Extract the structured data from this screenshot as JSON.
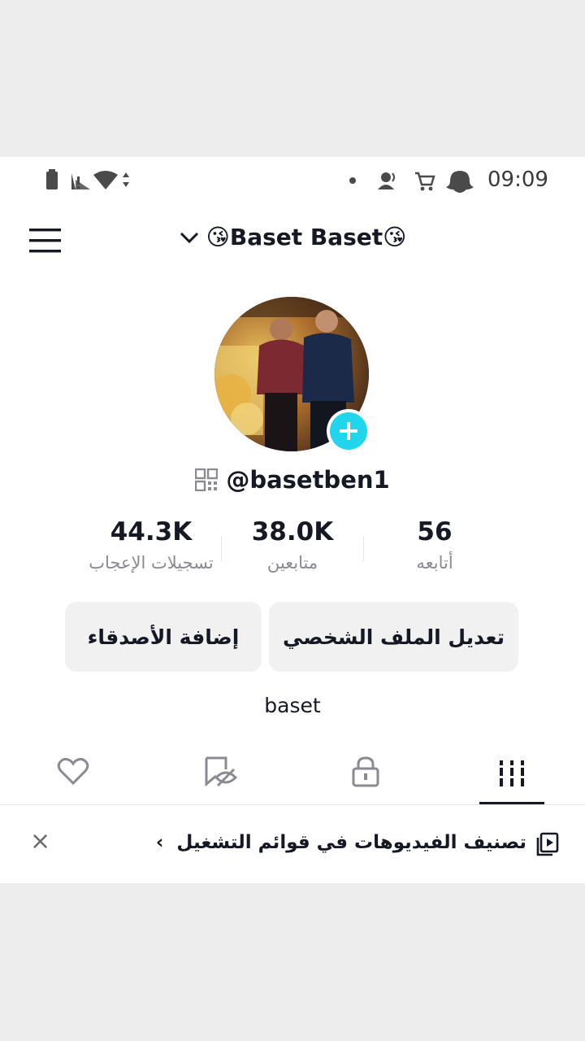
{
  "status_bar": {
    "time": "09:09",
    "icons_left": [
      "battery-icon",
      "no-signal-icon",
      "wifi-icon",
      "data-arrows-icon"
    ],
    "icons_right": [
      "dot-icon",
      "person-voice-icon",
      "cart-icon",
      "snapchat-icon"
    ]
  },
  "header": {
    "title": "😘Baset Baset😘",
    "menu_icon": "hamburger-menu-icon",
    "dropdown_icon": "chevron-down-icon"
  },
  "profile": {
    "username": "@basetben1",
    "bio": "baset",
    "add_icon": "plus-icon",
    "qr_icon": "qr-code-icon"
  },
  "stats": [
    {
      "value": "44.3K",
      "label": "تسجيلات الإعجاب"
    },
    {
      "value": "38.0K",
      "label": "متابعين"
    },
    {
      "value": "56",
      "label": "أتابعه"
    }
  ],
  "buttons": {
    "add_friends": "إضافة الأصدقاء",
    "edit_profile": "تعديل الملف الشخصي"
  },
  "tabs": [
    {
      "icon": "heart-icon"
    },
    {
      "icon": "bookmark-hidden-icon"
    },
    {
      "icon": "lock-icon"
    },
    {
      "icon": "grid-icon",
      "active": true
    }
  ],
  "playlist_banner": {
    "text": "تصنيف الفيديوهات في قوائم التشغيل",
    "chevron": "›",
    "close": "×"
  },
  "colors": {
    "text": "#161823",
    "muted": "#8a8b91",
    "button_bg": "#f1f1f2",
    "accent": "#20d5ec"
  }
}
